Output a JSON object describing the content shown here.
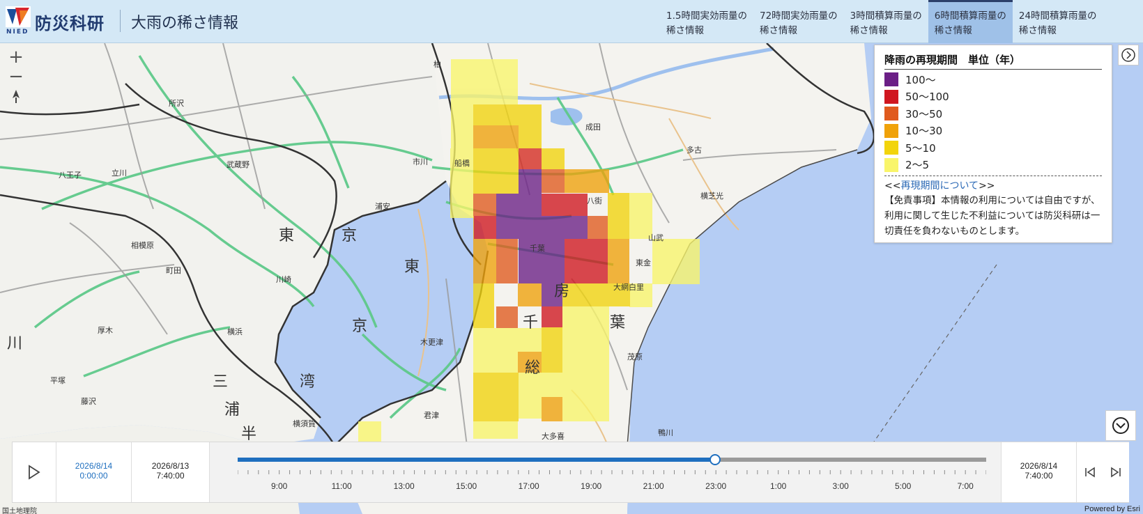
{
  "header": {
    "logo_text": "NIED",
    "brand": "防災科研",
    "title": "大雨の稀さ情報",
    "tabs": [
      {
        "label": "1.5時間実効雨量の\n稀さ情報",
        "active": false
      },
      {
        "label": "72時間実効雨量の\n稀さ情報",
        "active": false
      },
      {
        "label": "3時間積算雨量の\n稀さ情報",
        "active": false
      },
      {
        "label": "6時間積算雨量の\n稀さ情報",
        "active": true
      },
      {
        "label": "24時間積算雨量の\n稀さ情報",
        "active": false
      }
    ]
  },
  "map": {
    "zoom_in": "+",
    "zoom_out": "−",
    "place_labels": [
      "東",
      "京",
      "東",
      "京",
      "湾",
      "房",
      "千",
      "葉",
      "総",
      "三",
      "浦",
      "半",
      "川",
      "山武",
      "八街",
      "成田",
      "柏",
      "市川",
      "浦安",
      "船橋",
      "千葉",
      "茂原",
      "木更津",
      "君津",
      "大網白里",
      "東金",
      "横芝光",
      "多古",
      "所沢",
      "町田",
      "八王子",
      "立川",
      "武蔵野",
      "川崎",
      "横浜",
      "横須賀",
      "藤沢",
      "平塚",
      "厚木",
      "相模原",
      "大多喜",
      "鴨川"
    ],
    "attribution_left": "国土地理院",
    "attribution_right": "Powered by Esri"
  },
  "legend": {
    "title": "降雨の再現期間　単位（年）",
    "items": [
      {
        "label": "100～",
        "color": "#6b1f86"
      },
      {
        "label": "50～100",
        "color": "#d0161f"
      },
      {
        "label": "30～50",
        "color": "#e05a1e"
      },
      {
        "label": "10～30",
        "color": "#f0a20a"
      },
      {
        "label": "5～10",
        "color": "#f2d40c"
      },
      {
        "label": "2～5",
        "color": "#f9f56a"
      }
    ],
    "link_prefix": "<<",
    "link_text": "再現期間について",
    "link_suffix": ">>",
    "disclaimer": "【免責事項】本情報の利用については自由ですが、利用に関して生じた不利益については防災科研は一切責任を負わないものとします。"
  },
  "timebar": {
    "current_date": "2026/8/14",
    "current_time": "0:00:00",
    "start_date": "2026/8/13",
    "start_time": "7:40:00",
    "end_date": "2026/8/14",
    "end_time": "7:40:00",
    "progress": 0.638,
    "tick_labels": [
      "9:00",
      "11:00",
      "13:00",
      "15:00",
      "17:00",
      "19:00",
      "21:00",
      "23:00",
      "1:00",
      "3:00",
      "5:00",
      "7:00"
    ]
  }
}
